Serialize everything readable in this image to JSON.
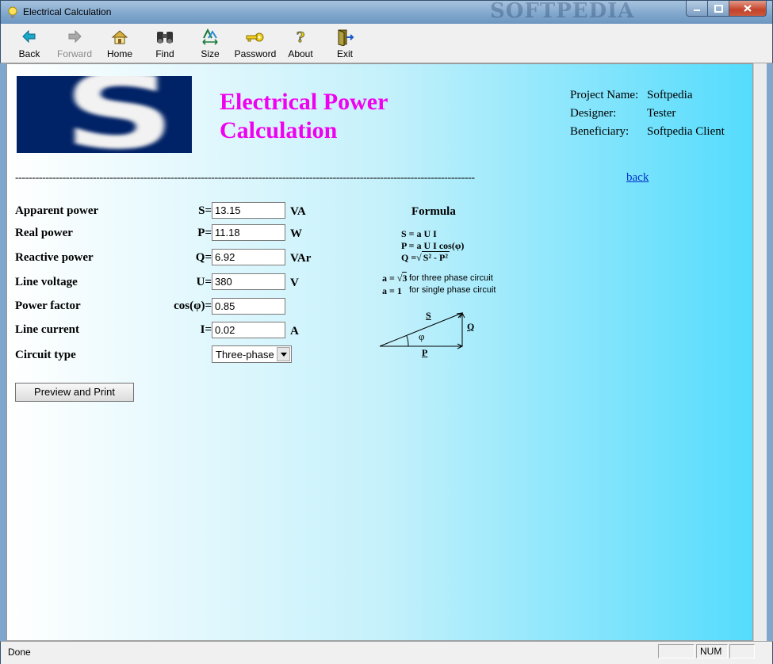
{
  "window": {
    "title": "Electrical Calculation",
    "watermark": "SOFTPEDIA"
  },
  "toolbar": {
    "back": "Back",
    "forward": "Forward",
    "home": "Home",
    "find": "Find",
    "size": "Size",
    "password": "Password",
    "about": "About",
    "exit": "Exit"
  },
  "page": {
    "title_line1": "Electrical Power",
    "title_line2": "Calculation",
    "separator": "----------------------------------------------------------------------------------------------------------------------------------------",
    "back_link": "back"
  },
  "project": {
    "name_label": "Project Name:",
    "name": "Softpedia",
    "designer_label": "Designer:",
    "designer": "Tester",
    "beneficiary_label": "Beneficiary:",
    "beneficiary": "Softpedia Client"
  },
  "fields": {
    "apparent": {
      "label": "Apparent power",
      "symbol": "S=",
      "value": "13.15",
      "unit": "VA"
    },
    "real": {
      "label": "Real power",
      "symbol": "P=",
      "value": "11.18",
      "unit": "W"
    },
    "reactive": {
      "label": "Reactive power",
      "symbol": "Q=",
      "value": "6.92",
      "unit": "VAr"
    },
    "voltage": {
      "label": "Line voltage",
      "symbol": "U=",
      "value": "380",
      "unit": "V"
    },
    "pf": {
      "label": "Power factor",
      "symbol": "cos(φ)=",
      "value": "0.85"
    },
    "current": {
      "label": "Line current",
      "symbol": "I=",
      "value": "0.02",
      "unit": "A"
    },
    "circuit": {
      "label": "Circuit type",
      "selected": "Three-phase"
    }
  },
  "preview_button": "Preview and Print",
  "formula": {
    "title": "Formula",
    "f1": "S = a U I",
    "f2": "P = a U I cos(φ)",
    "f3_prefix": "Q =",
    "f3_radicand": "S² - P²",
    "a1": "a = ",
    "a1_root": "3",
    "a1_text": "for three phase circuit",
    "a2": "a = 1",
    "a2_text": "for single phase circuit",
    "tri_s": "S",
    "tri_q": "Q",
    "tri_p": "P",
    "tri_phi": "φ"
  },
  "status": {
    "text": "Done",
    "num": "NUM"
  }
}
